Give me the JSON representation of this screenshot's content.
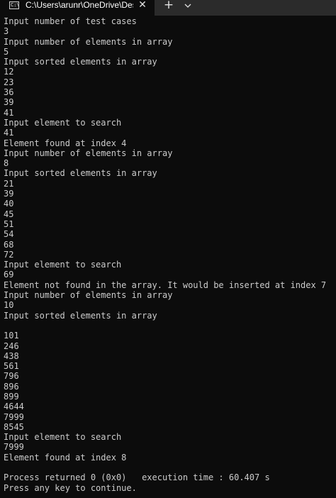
{
  "tab": {
    "icon": "terminal-icon",
    "title": "C:\\Users\\arunr\\OneDrive\\Des",
    "close_glyph": "✕",
    "new_tab_glyph": "+"
  },
  "console": {
    "lines": [
      "Input number of test cases",
      "3",
      "Input number of elements in array",
      "5",
      "Input sorted elements in array",
      "12",
      "23",
      "36",
      "39",
      "41",
      "Input element to search",
      "41",
      "Element found at index 4",
      "Input number of elements in array",
      "8",
      "Input sorted elements in array",
      "21",
      "39",
      "40",
      "45",
      "51",
      "54",
      "68",
      "72",
      "Input element to search",
      "69",
      "Element not found in the array. It would be inserted at index 7",
      "Input number of elements in array",
      "10",
      "Input sorted elements in array",
      "",
      "101",
      "246",
      "438",
      "561",
      "796",
      "896",
      "899",
      "4644",
      "7999",
      "8545",
      "Input element to search",
      "7999",
      "Element found at index 8",
      "",
      "Process returned 0 (0x0)   execution time : 60.407 s",
      "Press any key to continue."
    ]
  }
}
